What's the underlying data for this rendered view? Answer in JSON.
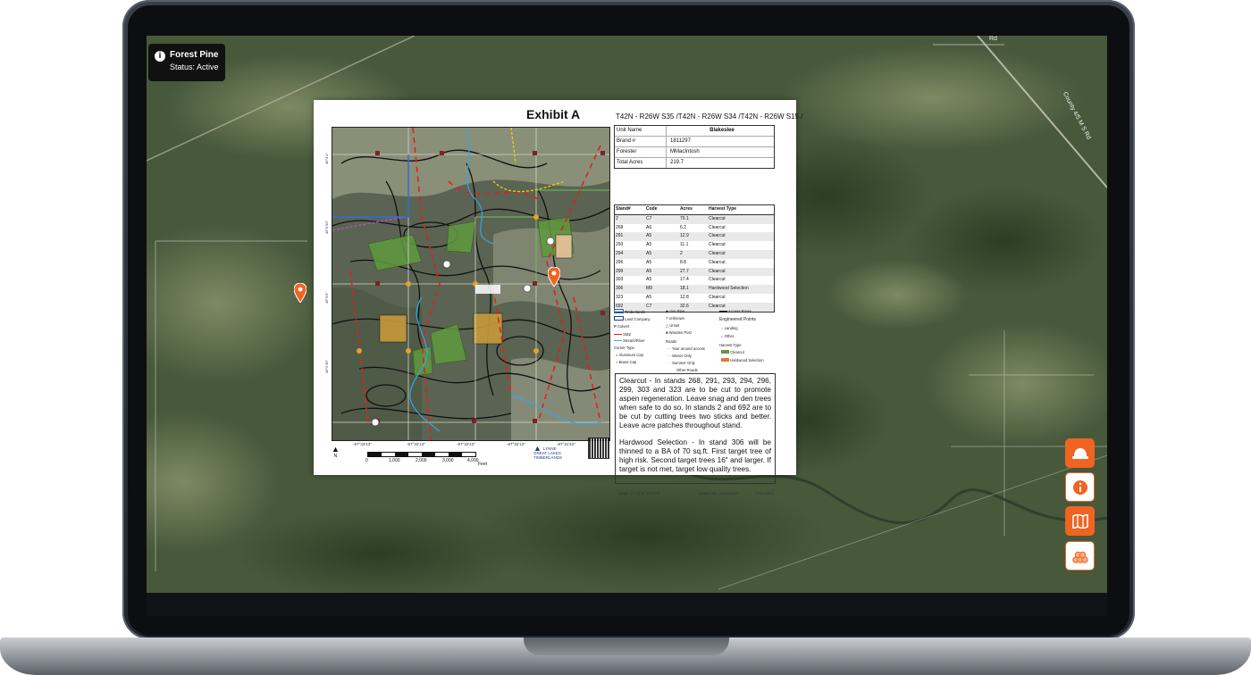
{
  "badge": {
    "title": "Forest Pine",
    "status": "Status: Active"
  },
  "map": {
    "road_label": "County 4/5 M S Rd",
    "corner_label": "Rd"
  },
  "exhibit": {
    "title": "Exhibit A",
    "trs": "T42N - R26W S35 /T42N - R26W S34 /T42N - R26W S15 /",
    "summary": [
      {
        "label": "Unit Name",
        "value": "Blakeslee"
      },
      {
        "label": "Brand #",
        "value": "1811297"
      },
      {
        "label": "Forester",
        "value": "MMacIntosh"
      },
      {
        "label": "Total Acres",
        "value": "219.7"
      }
    ],
    "stand_headers": [
      "Stand#",
      "Code",
      "Acres",
      "Harvest Type"
    ],
    "stands": [
      [
        "2",
        "C7",
        "70.1",
        "Clearcut"
      ],
      [
        "268",
        "A6",
        "6.2",
        "Clearcut"
      ],
      [
        "291",
        "A5",
        "12.9",
        "Clearcut"
      ],
      [
        "293",
        "A5",
        "11.1",
        "Clearcut"
      ],
      [
        "294",
        "A5",
        "2",
        "Clearcut"
      ],
      [
        "296",
        "A5",
        "8.8",
        "Clearcut"
      ],
      [
        "299",
        "A5",
        "27.7",
        "Clearcut"
      ],
      [
        "303",
        "A5",
        "17.4",
        "Clearcut"
      ],
      [
        "306",
        "M9",
        "18.1",
        "Hardwood Selection"
      ],
      [
        "323",
        "A5",
        "12.8",
        "Clearcut"
      ],
      [
        "692",
        "C7",
        "32.6",
        "Clearcut"
      ]
    ],
    "legend": {
      "timberlands": "Timberlands",
      "land_company": "Land Company",
      "culvert": "Culvert",
      "smz": "SMZ",
      "stream": "Stream/River",
      "corner_type": "Corner Type",
      "aluminum_cap": "Aluminum Cap",
      "brass_cap": "Brass Cap",
      "iron_pipe": "Iron Pipe",
      "unknown": "Unknown",
      "unset": "Unset",
      "wooden_post": "Wooden Post",
      "roads": "Roads",
      "year_around": "Year around access",
      "winter_only": "Winter Only",
      "summer_only": "Summer Only",
      "other_roads": "Other Roads",
      "access_route": "Access Route",
      "engineered_points": "Engineered Points",
      "landing": "Landing",
      "other": "Other",
      "harvest_type": "Harvest Type",
      "clearcut": "Clearcut",
      "hardwood_selection": "Hardwood Selection"
    },
    "notes": [
      "Clearcut - In stands 268, 291, 293, 294, 296, 299, 303 and 323 are to be cut to promote aspen regeneration. Leave snag and den trees when safe to do so. In stands 2 and 692 are to be cut by cutting trees two sticks and better. Leave acre patches throughout stand.",
      "Hardwood Selection - In stand 306 will be thinned to a BA of 70 sq.ft. First target tree of high risk. Second target trees 16\" and larger. If target is not met, target low quality trees."
    ],
    "lat_labels": [
      "46°4'1\"",
      "46°3'30\"",
      "46°3'0\"",
      "46°2'30\""
    ],
    "lon_labels": [
      "-87°33'43\"",
      "-87°33'13\"",
      "-87°32'43\"",
      "-87°32'13\"",
      "-87°31'43\""
    ],
    "scale_numbers": [
      "0",
      "1,000",
      "2,000",
      "3,000",
      "4,000"
    ],
    "scale_unit": "Feet",
    "north": "N",
    "logo": [
      "LYNNE",
      "GREAT LAKES",
      "TIMBERLANDS"
    ],
    "footer_center": "Center: 87.54°W 46.01°N",
    "footer_created": "Created By:  mmacintosh",
    "footer_date": "10/21/2024"
  },
  "toolbar": {
    "items": [
      {
        "name": "hardhat-icon",
        "style": "orange"
      },
      {
        "name": "info-icon",
        "style": "white"
      },
      {
        "name": "map-icon",
        "style": "orange"
      },
      {
        "name": "logs-icon",
        "style": "white"
      }
    ]
  },
  "colors": {
    "accent": "#f06422",
    "badge_bg": "#111111"
  }
}
